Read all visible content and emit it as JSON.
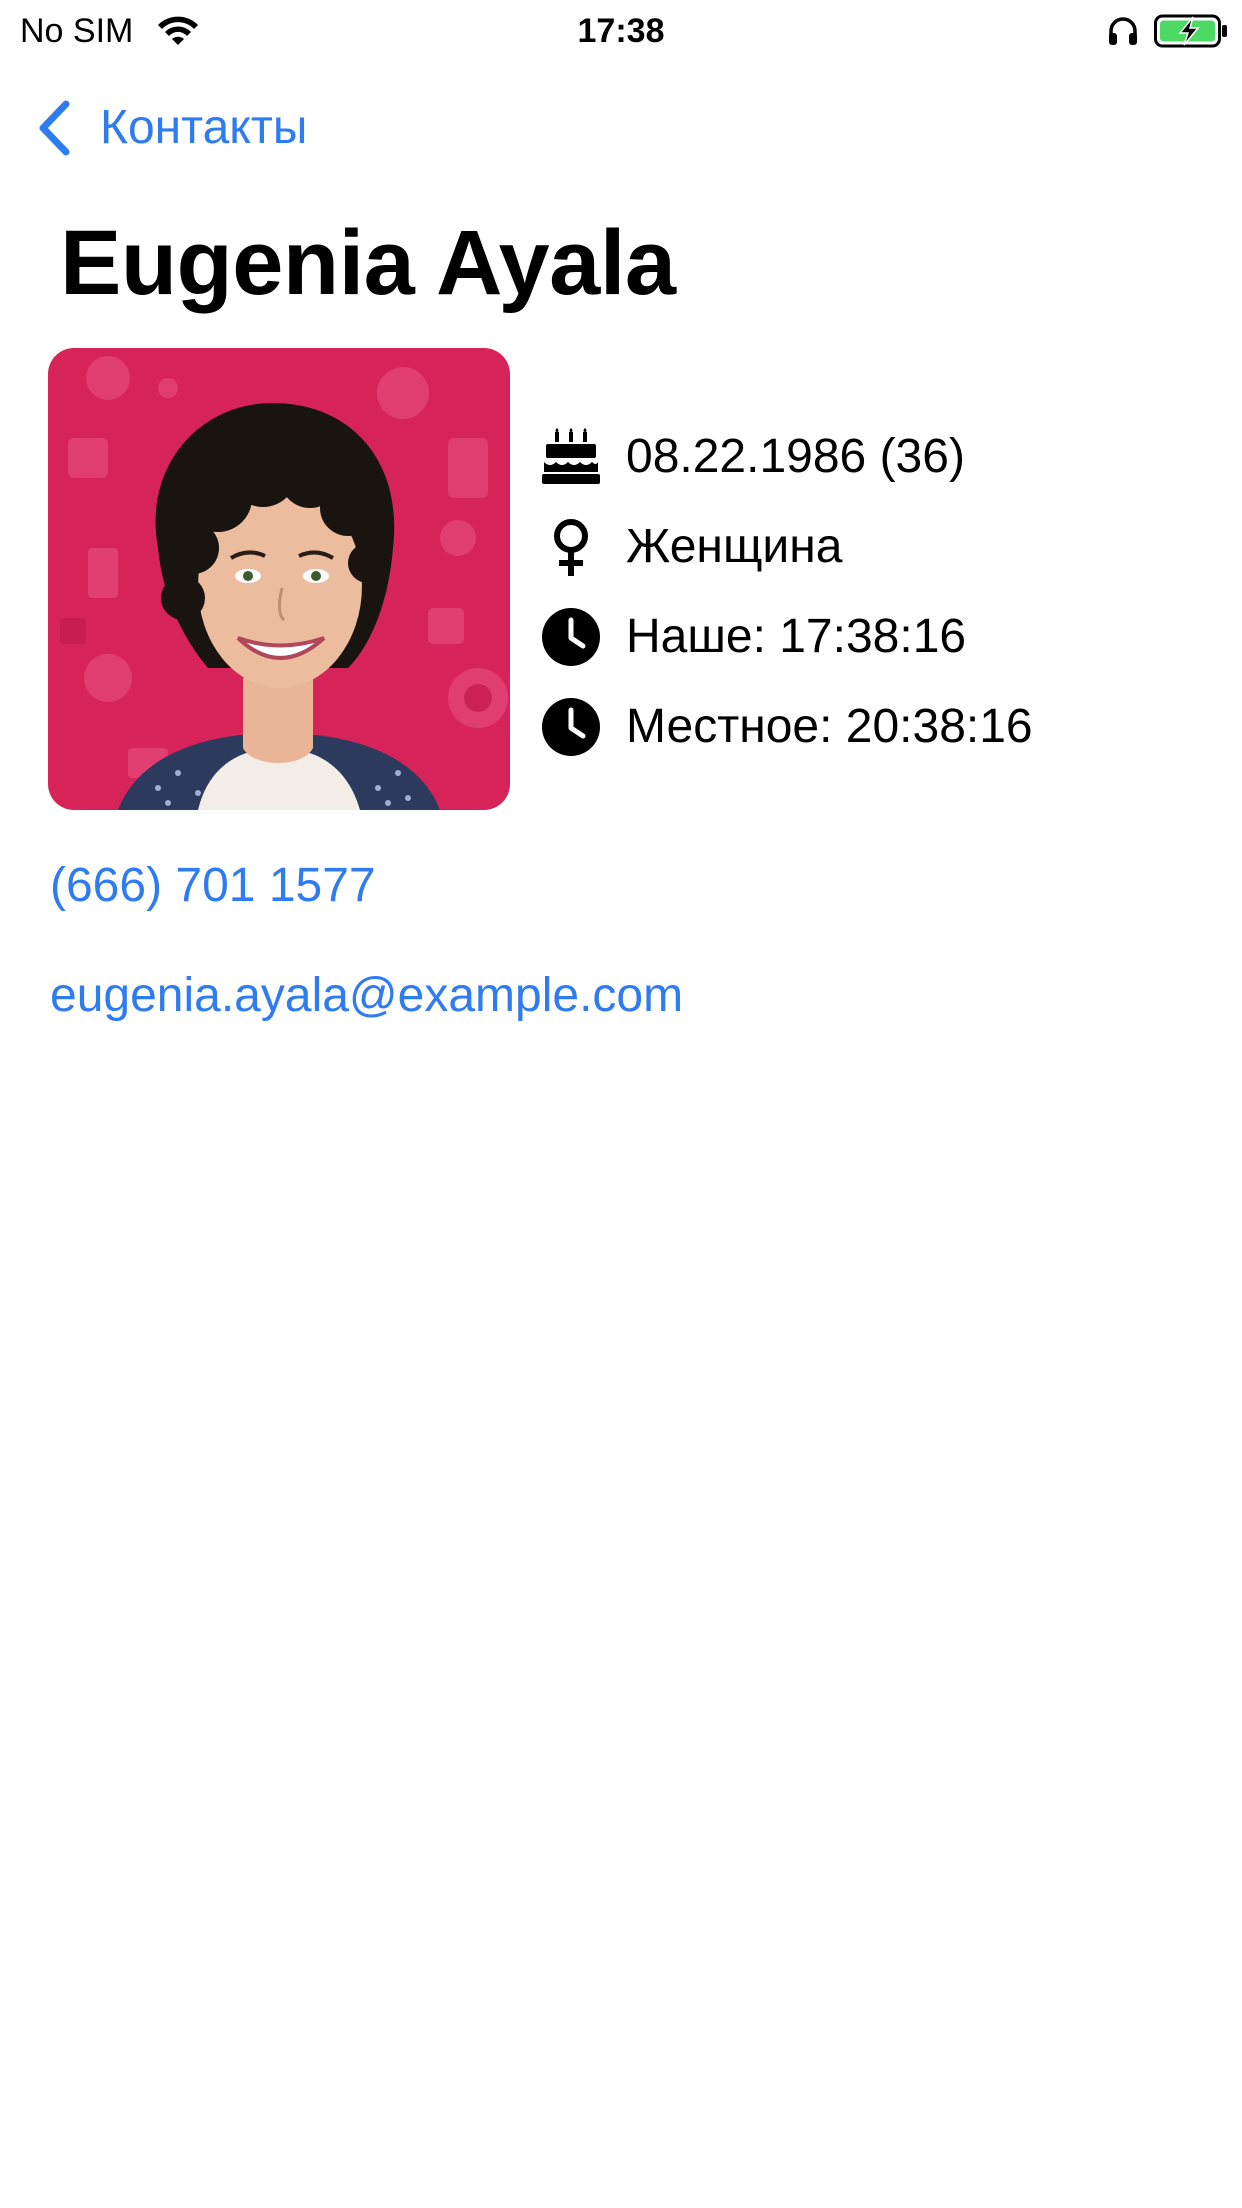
{
  "status_bar": {
    "carrier": "No SIM",
    "time": "17:38",
    "battery_color": "#4cd964"
  },
  "navigation": {
    "back_label": "Контакты"
  },
  "contact": {
    "name": "Eugenia Ayala",
    "details": [
      {
        "icon": "birthday-cake-icon",
        "text": "08.22.1986 (36)"
      },
      {
        "icon": "female-symbol-icon",
        "text": "Женщина"
      },
      {
        "icon": "clock-icon",
        "text": "Наше: 17:38:16"
      },
      {
        "icon": "clock-icon",
        "text": "Местное: 20:38:16"
      }
    ],
    "phone": "(666) 701 1577",
    "email": "eugenia.ayala@example.com"
  },
  "colors": {
    "accent": "#2f7bf0",
    "avatar_background": "#d6245a"
  }
}
